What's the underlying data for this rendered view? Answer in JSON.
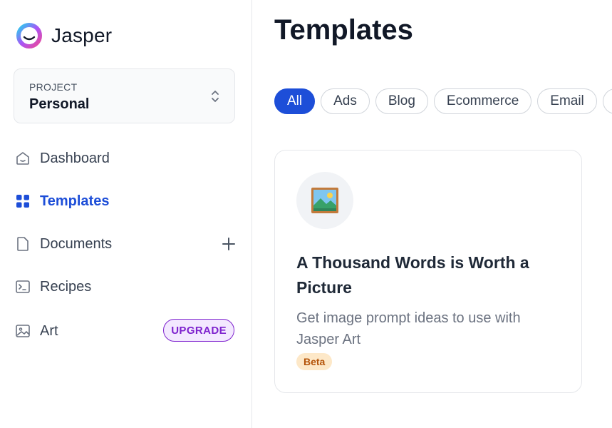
{
  "app": {
    "name": "Jasper"
  },
  "project": {
    "label": "PROJECT",
    "name": "Personal"
  },
  "nav": [
    {
      "label": "Dashboard",
      "icon": "home-icon"
    },
    {
      "label": "Templates",
      "icon": "grid-icon",
      "active": true
    },
    {
      "label": "Documents",
      "icon": "document-icon"
    },
    {
      "label": "Recipes",
      "icon": "terminal-icon"
    },
    {
      "label": "Art",
      "icon": "image-icon",
      "badge": "UPGRADE"
    }
  ],
  "main": {
    "title": "Templates",
    "filters": [
      "All",
      "Ads",
      "Blog",
      "Ecommerce",
      "Email"
    ],
    "active_filter": "All"
  },
  "card": {
    "title": "A Thousand Words is Worth a Picture",
    "description": "Get image prompt ideas to use with Jasper Art",
    "badge": "Beta",
    "icon": "framed-picture-icon"
  },
  "colors": {
    "accent": "#1d4ed8",
    "upgrade": "#7e22ce",
    "beta_bg": "#fde8c8",
    "beta_text": "#b45309"
  }
}
